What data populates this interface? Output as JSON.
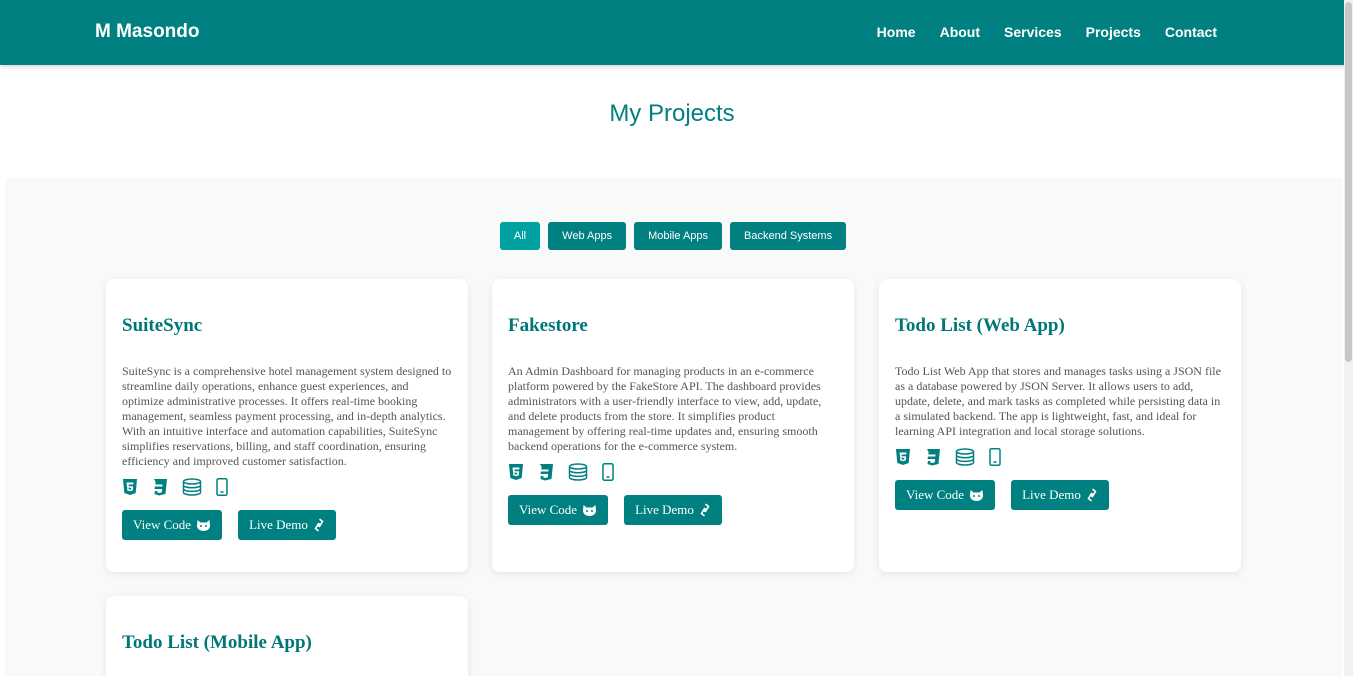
{
  "nav": {
    "brand": "M Masondo",
    "links": [
      "Home",
      "About",
      "Services",
      "Projects",
      "Contact"
    ]
  },
  "page_title": "My Projects",
  "filters": [
    "All",
    "Web Apps",
    "Mobile Apps",
    "Backend Systems"
  ],
  "active_filter": "All",
  "projects": [
    {
      "title": "SuiteSync",
      "description": "SuiteSync is a comprehensive hotel management system designed to streamline daily operations, enhance guest experiences, and optimize administrative processes. It offers real-time booking management, seamless payment processing, and in-depth analytics. With an intuitive interface and automation capabilities, SuiteSync simplifies reservations, billing, and staff coordination, ensuring efficiency and improved customer satisfaction.",
      "icons": [
        "html5-icon",
        "css3-icon",
        "database-icon",
        "mobile-icon"
      ],
      "view_code_label": "View Code",
      "live_demo_label": "Live Demo"
    },
    {
      "title": "Fakestore",
      "description": "An Admin Dashboard for managing products in an e-commerce platform powered by the FakeStore API. The dashboard provides administrators with a user-friendly interface to view, add, update, and delete products from the store. It simplifies product management by offering real-time updates and, ensuring smooth backend operations for the e-commerce system.",
      "icons": [
        "html5-icon",
        "css3-icon",
        "database-icon",
        "mobile-icon"
      ],
      "view_code_label": "View Code",
      "live_demo_label": "Live Demo"
    },
    {
      "title": "Todo List (Web App)",
      "description": "Todo List Web App that stores and manages tasks using a JSON file as a database powered by JSON Server. It allows users to add, update, delete, and mark tasks as completed while persisting data in a simulated backend. The app is lightweight, fast, and ideal for learning API integration and local storage solutions.",
      "icons": [
        "html5-icon",
        "css3-icon",
        "database-icon",
        "mobile-icon"
      ],
      "view_code_label": "View Code",
      "live_demo_label": "Live Demo"
    },
    {
      "title": "Todo List (Mobile App)"
    }
  ],
  "colors": {
    "primary": "#008080",
    "active_filter": "#00a1a1",
    "section_bg": "#f8f9f9"
  }
}
